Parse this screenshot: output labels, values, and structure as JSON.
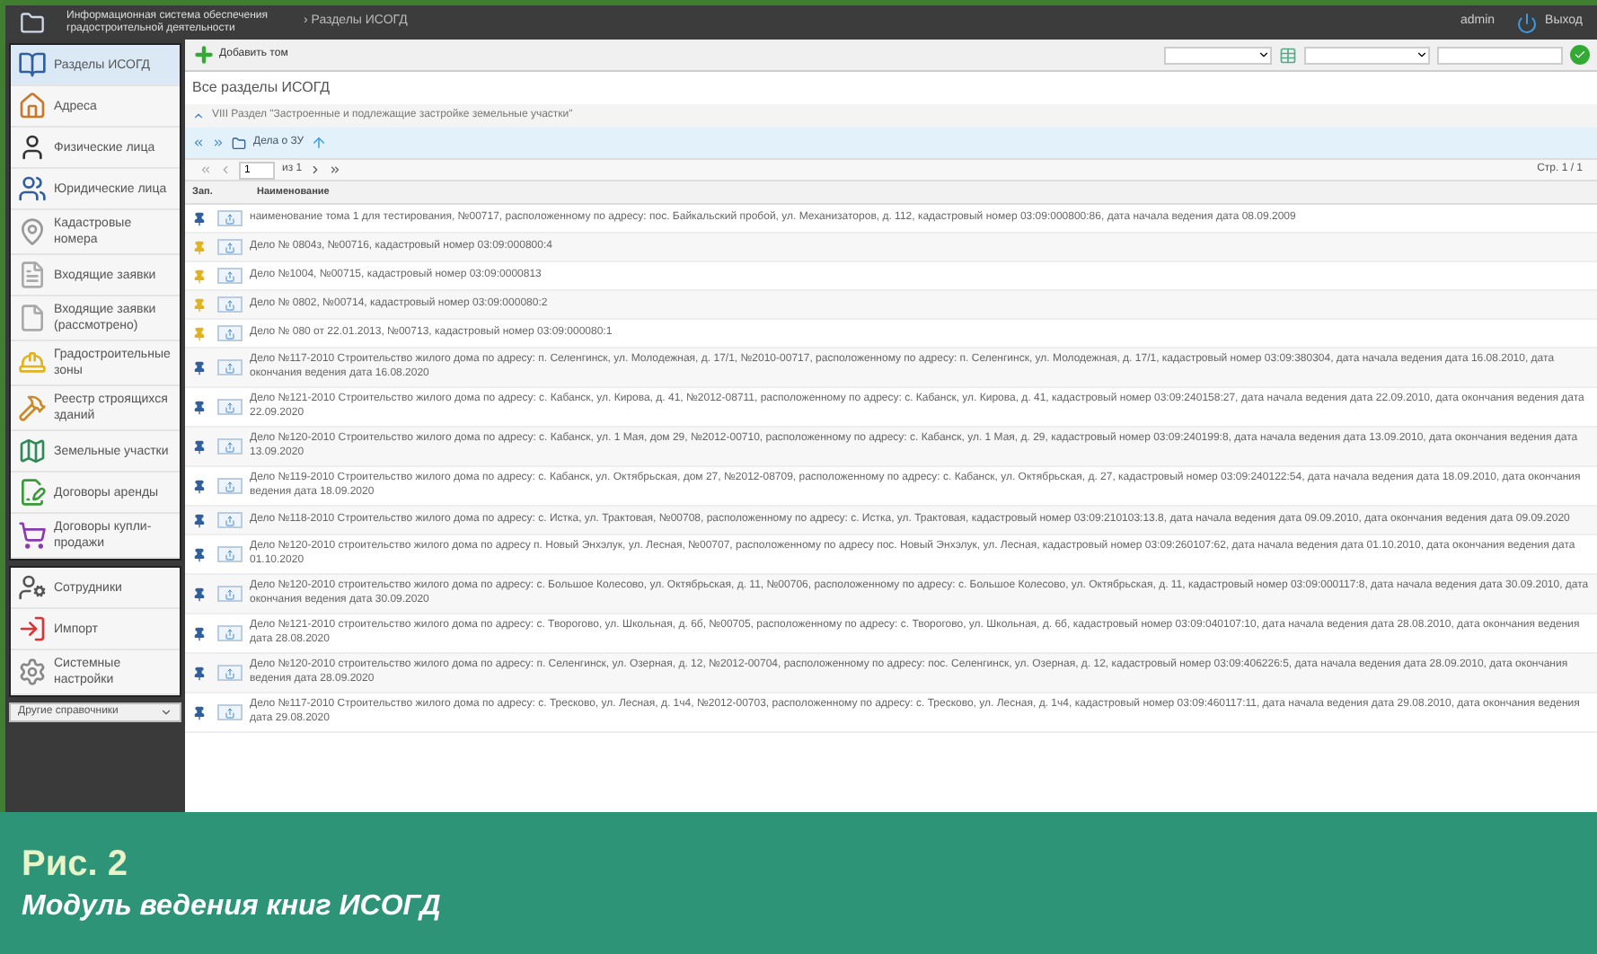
{
  "header": {
    "system_title": "Информационная система обеспечения градостроительной деятельности",
    "breadcrumb": "› Разделы ИСОГД",
    "user": "admin",
    "logout": "Выход"
  },
  "sidebar": {
    "groups": [
      {
        "items": [
          {
            "label": "Разделы ИСОГД",
            "selected": true
          },
          {
            "label": "Адреса",
            "selected": false
          },
          {
            "label": "Физические лица",
            "selected": false
          },
          {
            "label": "Юридические лица",
            "selected": false
          },
          {
            "label": "Кадастровые номера",
            "selected": false
          },
          {
            "label": "Входящие заявки",
            "selected": false
          },
          {
            "label": "Входящие заявки (рассмотрено)",
            "selected": false
          },
          {
            "label": "Градостроительные зоны",
            "selected": false
          },
          {
            "label": "Реестр строящихся зданий",
            "selected": false
          },
          {
            "label": "Земельные участки",
            "selected": false
          },
          {
            "label": "Договоры аренды",
            "selected": false
          },
          {
            "label": "Договоры купли-продажи",
            "selected": false
          }
        ]
      },
      {
        "items": [
          {
            "label": "Сотрудники",
            "selected": false
          },
          {
            "label": "Импорт",
            "selected": false
          },
          {
            "label": "Системные настройки",
            "selected": false
          }
        ]
      }
    ],
    "dropdown": "Другие справочники"
  },
  "toolbar": {
    "add_button": "Добавить том"
  },
  "page_title": "Все разделы ИСОГД",
  "section_path": "VIII Раздел \"Застроенные и подлежащие застройке земельные участки\"",
  "folder": "Дела о ЗУ",
  "pager": {
    "page": "1",
    "of": "из 1",
    "summary": "Стр. 1 / 1"
  },
  "table": {
    "columns": [
      "Зап.",
      "Наименование"
    ],
    "rows": [
      {
        "color": "#2f5f9e",
        "text": "наименование тома 1 для тестирования, №00717, расположенному по адресу: пос. Байкальский пробой, ул. Механизаторов, д. 112, кадастровый номер 03:09:000800:86, дата начала ведения дата 08.09.2009"
      },
      {
        "color": "#e2b320",
        "text": "Дело № 0804з, №00716, кадастровый номер 03:09:000800:4"
      },
      {
        "color": "#e2b320",
        "text": "Дело №1004, №00715, кадастровый номер 03:09:0000813"
      },
      {
        "color": "#e2b320",
        "text": "Дело № 0802, №00714, кадастровый номер 03:09:000080:2"
      },
      {
        "color": "#e2b320",
        "text": "Дело № 080 от 22.01.2013, №00713, кадастровый номер 03:09:000080:1"
      },
      {
        "color": "#2f5f9e",
        "text": "Дело №117-2010 Строительство жилого дома по адресу: п. Селенгинск, ул. Молодежная, д. 17/1, №2010-00717, расположенному по адресу: п. Селенгинск, ул. Молодежная, д. 17/1, кадастровый номер 03:09:380304, дата начала ведения дата 16.08.2010, дата окончания ведения дата 16.08.2020"
      },
      {
        "color": "#2f5f9e",
        "text": "Дело №121-2010 Строительство жилого дома по адресу: с. Кабанск, ул. Кирова, д. 41, №2012-08711, расположенному по адресу: с. Кабанск, ул. Кирова, д. 41, кадастровый номер 03:09:240158:27, дата начала ведения дата 22.09.2010, дата окончания ведения дата 22.09.2020"
      },
      {
        "color": "#2f5f9e",
        "text": "Дело №120-2010 Строительство жилого дома по адресу: с. Кабанск, ул. 1 Мая, дом 29, №2012-00710, расположенному по адресу: с. Кабанск, ул. 1 Мая, д. 29, кадастровый номер 03:09:240199:8, дата начала ведения дата 13.09.2010, дата окончания ведения дата 13.09.2020"
      },
      {
        "color": "#2f5f9e",
        "text": "Дело №119-2010 Строительство жилого дома по адресу: с. Кабанск, ул. Октябрьская, дом 27, №2012-08709, расположенному по адресу: с. Кабанск, ул. Октябрьская, д. 27, кадастровый номер 03:09:240122:54, дата начала ведения дата 18.09.2010, дата окончания ведения дата 18.09.2020"
      },
      {
        "color": "#2f5f9e",
        "text": "Дело №118-2010 Строительство жилого дома по адресу: с. Истка, ул. Трактовая, №00708, расположенному по адресу: с. Истка, ул. Трактовая, кадастровый номер 03:09:210103:13.8, дата начала ведения дата 09.09.2010, дата окончания ведения дата 09.09.2020"
      },
      {
        "color": "#2f5f9e",
        "text": "Дело №120-2010 строительство жилого дома по адресу п. Новый Энхэлук, ул. Лесная, №00707, расположенному по адресу пос. Новый Энхэлук, ул. Лесная, кадастровый номер 03:09:260107:62, дата начала ведения дата 01.10.2010, дата окончания ведения дата 01.10.2020"
      },
      {
        "color": "#2f5f9e",
        "text": "Дело №120-2010 строительство жилого дома по адресу: с. Большое Колесово, ул. Октябрьская, д. 11, №00706, расположенному по адресу: с. Большое Колесово, ул. Октябрьская, д. 11, кадастровый номер 03:09:000117:8, дата начала ведения дата 30.09.2010, дата окончания ведения дата 30.09.2020"
      },
      {
        "color": "#2f5f9e",
        "text": "Дело №121-2010 строительство жилого дома по адресу: с. Творогово, ул. Школьная, д. 6б, №00705, расположенному по адресу: с. Творогово, ул. Школьная, д. 6б, кадастровый номер 03:09:040107:10, дата начала ведения дата 28.08.2010, дата окончания ведения дата 28.08.2020"
      },
      {
        "color": "#2f5f9e",
        "text": "Дело №120-2010 строительство жилого дома по адресу: п. Селенгинск, ул. Озерная, д. 12, №2012-00704, расположенному по адресу: пос. Селенгинск, ул. Озерная, д. 12, кадастровый номер 03:09:406226:5, дата начала ведения дата 28.09.2010, дата окончания ведения дата 28.09.2020"
      },
      {
        "color": "#2f5f9e",
        "text": "Дело №117-2010 Строительство жилого дома по адресу: с. Тресково, ул. Лесная, д. 1ч4, №2012-00703, расположенному по адресу: с. Тресково, ул. Лесная, д. 1ч4, кадастровый номер 03:09:460117:11, дата начала ведения дата 29.08.2010, дата окончания ведения дата 29.08.2020"
      }
    ]
  },
  "caption": {
    "figure": "Рис. 2",
    "title": "Модуль ведения книг ИСОГД"
  }
}
